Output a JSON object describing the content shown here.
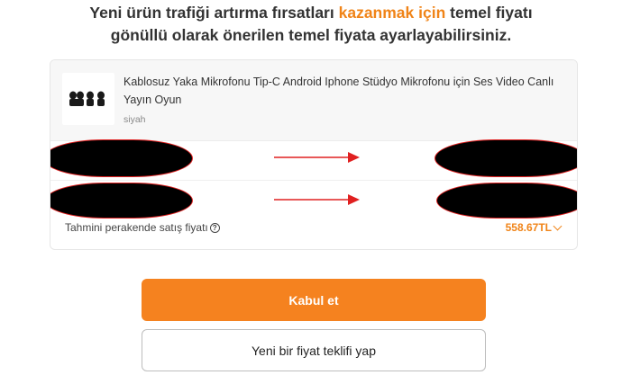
{
  "headline": {
    "line1_before": "Yeni ürün trafiği artırma fırsatları ",
    "line1_accent": "kazanmak için",
    "line1_after": " temel fiyatı",
    "line2": "gönüllü olarak önerilen temel fiyata ayarlayabilirsiniz."
  },
  "product": {
    "title": "Kablosuz Yaka Mikrofonu Tip-C Android Iphone Stüdyo Mikrofonu için Ses Video Canlı Yayın Oyun",
    "variant": "siyah",
    "thumbnail_icon": "lavalier-microphone-icon"
  },
  "estimate": {
    "label": "Tahmini perakende satış fiyatı",
    "help_icon": "help-circle-icon",
    "value": "558.67TL"
  },
  "buttons": {
    "accept": "Kabul et",
    "new_offer": "Yeni bir fiyat teklifi yap"
  },
  "colors": {
    "accent": "#f5821f",
    "accent_text": "#f08418",
    "arrow": "#e02020",
    "redaction": "#000000"
  }
}
